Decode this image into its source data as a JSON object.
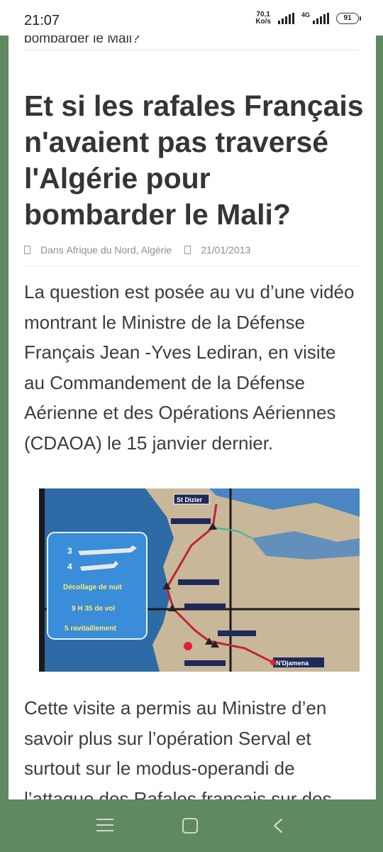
{
  "status_bar": {
    "time": "21:07",
    "speed_value": "70,1",
    "speed_unit": "Ko/s",
    "network": "4G",
    "battery": "91"
  },
  "article": {
    "previous_title_fragment": "bombarder le Mali?",
    "headline": "Et si les rafales Français n'avaient pas traversé l'Algérie pour bombarder le Mali?",
    "category_prefix": "Dans",
    "categories": "Afrique du Nord, Algérie",
    "date": "21/01/2013",
    "paragraph1": "La question est posée au vu d’une vidéo montrant le Ministre de la Défense Français Jean -Yves Lediran, en visite au Commandement de la Défense Aérienne et des Opérations Aériennes (CDAOA) le 15 janvier dernier.",
    "paragraph2": "Cette visite a permis au Ministre d’en savoir plus sur l’opération Serval et surtout sur le modus-operandi de l’attaque des Rafales français sur des"
  },
  "map_image": {
    "label_start": "St Dizier",
    "label_end": "N'Djamena",
    "legend_3": "3",
    "legend_4": "4",
    "legend_line1": "Décollage de nuit",
    "legend_line2": "9 H 35 de vol",
    "legend_line3": "5 ravitaillement",
    "colors": {
      "route": "#c0233a",
      "land": "#c9b79a",
      "sea": "#4a86c2"
    }
  },
  "nav_bar": {
    "menu_icon": "menu-icon",
    "home_icon": "home-icon",
    "back_icon": "back-icon"
  }
}
